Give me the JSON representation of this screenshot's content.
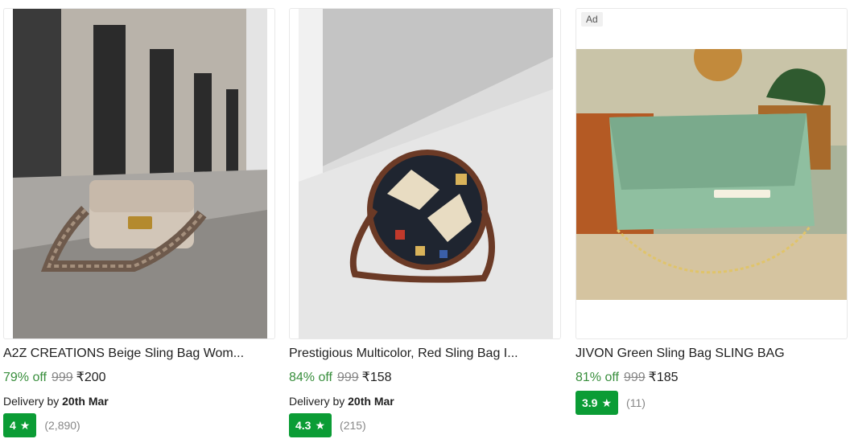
{
  "products": [
    {
      "title": "A2Z CREATIONS Beige Sling Bag Wom...",
      "discount": "79% off",
      "mrp": "999",
      "price": "₹200",
      "delivery_prefix": "Delivery by",
      "delivery_date": "20th Mar",
      "rating": "4",
      "rating_count": "(2,890)",
      "ad": ""
    },
    {
      "title": "Prestigious Multicolor, Red Sling Bag I...",
      "discount": "84% off",
      "mrp": "999",
      "price": "₹158",
      "delivery_prefix": "Delivery by",
      "delivery_date": "20th Mar",
      "rating": "4.3",
      "rating_count": "(215)",
      "ad": ""
    },
    {
      "title": "JIVON Green Sling Bag SLING BAG",
      "discount": "81% off",
      "mrp": "999",
      "price": "₹185",
      "delivery_prefix": "",
      "delivery_date": "",
      "rating": "3.9",
      "rating_count": "(11)",
      "ad": "Ad"
    }
  ],
  "colors": {
    "discount": "#388e3c",
    "rating_badge": "#0b9c35",
    "muted": "#878787"
  },
  "icons": {
    "rating": "star-icon"
  }
}
